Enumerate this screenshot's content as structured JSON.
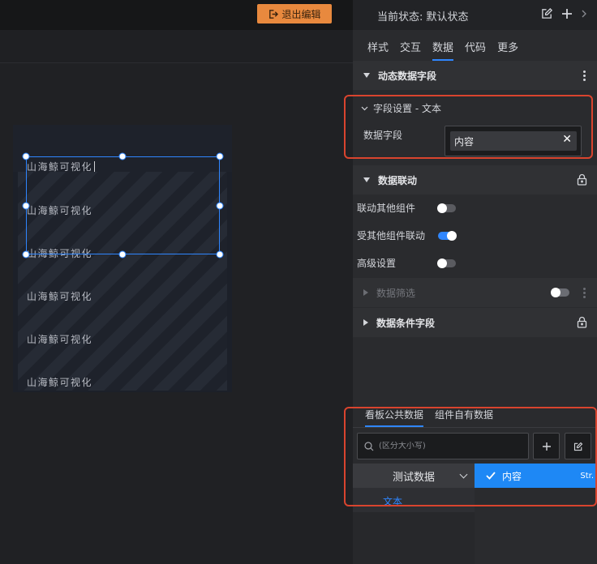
{
  "toolbar": {
    "exit_label": "退出编辑"
  },
  "canvas": {
    "rows": [
      "山海鲸可视化",
      "山海鲸可视化",
      "山海鲸可视化",
      "山海鲸可视化",
      "山海鲸可视化",
      "山海鲸可视化"
    ]
  },
  "panel": {
    "state_label": "当前状态:  默认状态",
    "tabs": [
      "样式",
      "交互",
      "数据",
      "代码",
      "更多"
    ],
    "active_tab": "数据",
    "sections": {
      "dynamic": "动态数据字段",
      "field_settings": "字段设置 - 文本",
      "field_label": "数据字段",
      "field_tag": "内容",
      "linkage": "数据联动",
      "link_others": "联动其他组件",
      "linked_by": "受其他组件联动",
      "advanced": "高级设置",
      "filter": "数据筛选",
      "conditional": "数据条件字段"
    },
    "bottom": {
      "tabs": [
        "看板公共数据",
        "组件自有数据"
      ],
      "search_placeholder": "(区分大小写)",
      "dataset": "测试数据",
      "field_name": "内容",
      "field_type": "Str.",
      "sub_item": "文本"
    }
  }
}
